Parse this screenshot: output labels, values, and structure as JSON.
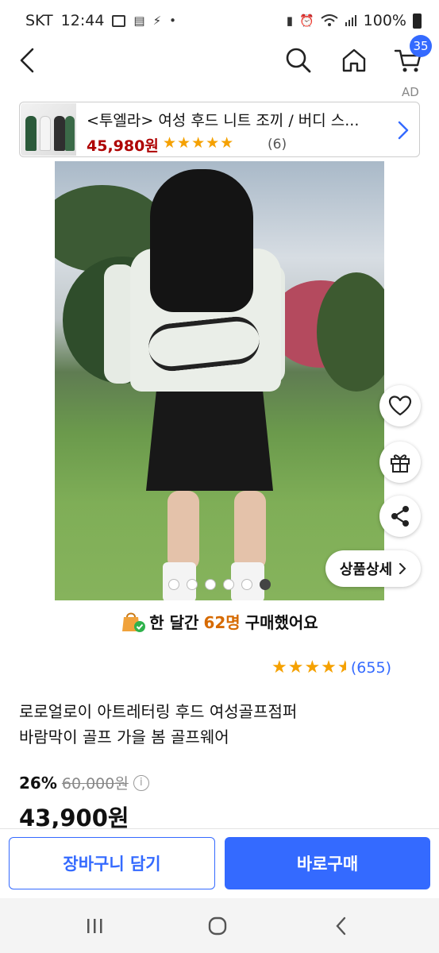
{
  "status_bar": {
    "carrier": "SKT",
    "time": "12:44",
    "battery": "100%"
  },
  "nav": {
    "cart_count": "35",
    "ad_label": "AD"
  },
  "ad": {
    "title": "<투엘라> 여성 후드 니트 조끼 / 버디 스...",
    "price": "45,980원",
    "stars": "★★★★★",
    "review_count": "(6)"
  },
  "gallery": {
    "dot_count": 6,
    "active_index": 5
  },
  "detail_button_label": "상품상세",
  "purchase_banner": {
    "prefix": "한 달간",
    "buyers": "62명",
    "suffix": "구매했어요"
  },
  "rating": {
    "value": 4.5,
    "stars": "★★★★",
    "review_count": "(655)"
  },
  "product": {
    "title_line1": "로로얼로이 아트레터링 후드 여성골프점퍼",
    "title_line2": "바람막이 골프 가을 봄 골프웨어",
    "discount": "26%",
    "original_price": "60,000원",
    "sale_price": "43,900원"
  },
  "actions": {
    "add_to_cart": "장바구니 담기",
    "buy_now": "바로구매"
  },
  "colors": {
    "accent": "#346aff",
    "ad_price": "#ae0000",
    "star": "#f5a100",
    "buyer_count": "#d66a00"
  }
}
